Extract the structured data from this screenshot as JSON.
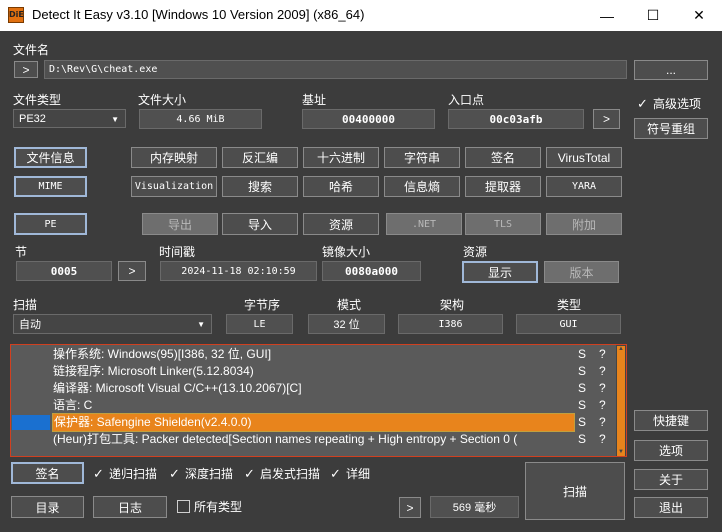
{
  "window": {
    "title": "Detect It Easy v3.10 [Windows 10 Version 2009] (x86_64)",
    "icon_text": "DiE"
  },
  "file": {
    "label": "文件名",
    "expand": ">",
    "path": "D:\\Rev\\G\\cheat.exe",
    "browse": "..."
  },
  "info": {
    "type_label": "文件类型",
    "type_value": "PE32",
    "size_label": "文件大小",
    "size_value": "4.66 MiB",
    "base_label": "基址",
    "base_value": "00400000",
    "entry_label": "入口点",
    "entry_value": "00c03afb",
    "entry_go": ">"
  },
  "advanced": {
    "label": "高级选项",
    "checked": true,
    "symbol_button": "符号重组"
  },
  "tools_row1": [
    "文件信息",
    "内存映射",
    "反汇编",
    "十六进制",
    "字符串",
    "签名",
    "VirusTotal"
  ],
  "tools_row2": [
    "MIME",
    "Visualization",
    "搜索",
    "哈希",
    "信息熵",
    "提取器",
    "YARA"
  ],
  "pe_row": [
    "PE",
    "导出",
    "导入",
    "资源",
    ".NET",
    "TLS",
    "附加"
  ],
  "sections": {
    "section_label": "节",
    "section_value": "0005",
    "section_go": ">",
    "time_label": "时间戳",
    "time_value": "2024-11-18 02:10:59",
    "image_label": "镜像大小",
    "image_value": "0080a000",
    "resource_label": "资源",
    "resource_show": "显示",
    "resource_version": "版本"
  },
  "scan": {
    "label": "扫描",
    "mode": "自动",
    "endian_label": "字节序",
    "endian_value": "LE",
    "mode_label": "模式",
    "mode_value": "32 位",
    "arch_label": "架构",
    "arch_value": "I386",
    "type_label": "类型",
    "type_value": "GUI"
  },
  "results": [
    {
      "text": "操作系统: Windows(95)[I386, 32 位, GUI]",
      "s": "S",
      "q": "?"
    },
    {
      "text": "链接程序: Microsoft Linker(5.12.8034)",
      "s": "S",
      "q": "?"
    },
    {
      "text": "编译器: Microsoft Visual C/C++(13.10.2067)[C]",
      "s": "S",
      "q": "?"
    },
    {
      "text": "语言: C",
      "s": "S",
      "q": "?"
    },
    {
      "text": "保护器: Safengine Shielden(v2.4.0.0)",
      "s": "S",
      "q": "?"
    },
    {
      "text": "(Heur)打包工具: Packer detected[Section names repeating + High entropy + Section 0 (",
      "s": "S",
      "q": "?"
    }
  ],
  "side_buttons": [
    "快捷键",
    "选项",
    "关于",
    "退出"
  ],
  "bottom": {
    "signature": "签名",
    "recursive": "递归扫描",
    "deep": "深度扫描",
    "heuristic": "启发式扫描",
    "verbose": "详细",
    "directory": "目录",
    "log": "日志",
    "all_types": "所有类型",
    "go": ">",
    "elapsed": "569 毫秒",
    "scan_button": "扫描"
  }
}
